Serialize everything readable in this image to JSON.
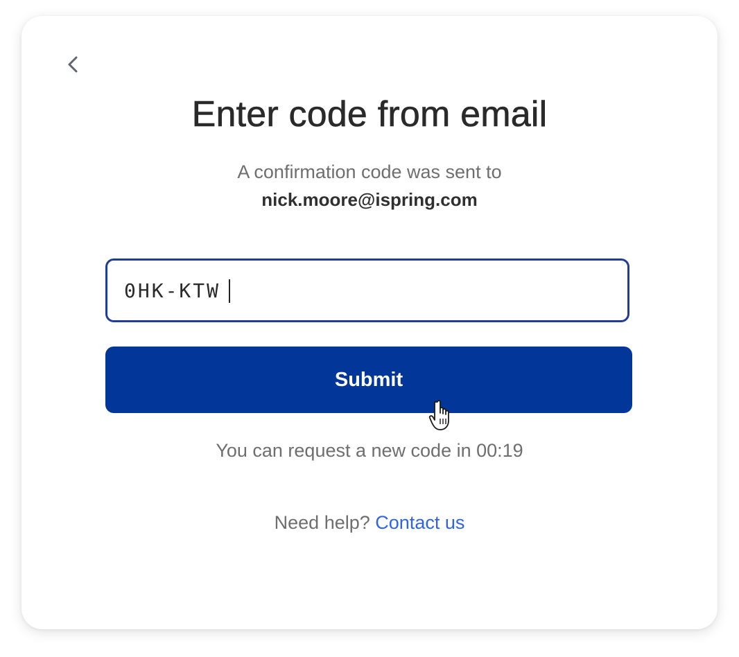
{
  "header": {
    "back_icon": "chevron-left-icon",
    "title": "Enter code from email"
  },
  "confirmation": {
    "message": "A confirmation code was sent to",
    "email": "nick.moore@ispring.com"
  },
  "code_input": {
    "value": "0HK-KTW"
  },
  "submit": {
    "label": "Submit"
  },
  "timer": {
    "text": "You can request a new code in 00:19"
  },
  "help": {
    "prefix": "Need help?",
    "link_label": "Contact us"
  },
  "colors": {
    "accent": "#023699",
    "link": "#2f63e8",
    "input_border": "#1f3d94"
  }
}
